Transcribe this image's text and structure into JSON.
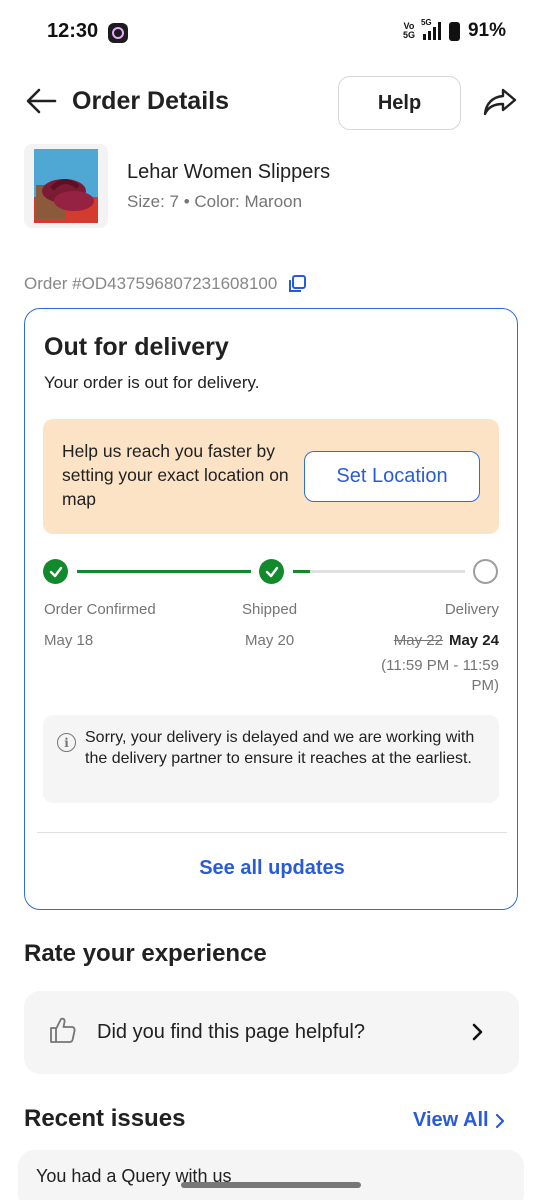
{
  "status_bar": {
    "time": "12:30",
    "network_top": "Vo",
    "network_bottom": "5G",
    "signal_label": "5G",
    "battery": "91%"
  },
  "header": {
    "title": "Order Details",
    "help_label": "Help"
  },
  "product": {
    "name": "Lehar Women Slippers",
    "meta": "Size: 7 • Color: Maroon"
  },
  "order": {
    "id": "Order #OD437596807231608100"
  },
  "status_card": {
    "title": "Out for delivery",
    "subtitle": "Your order is out for delivery.",
    "location_prompt": "Help us reach you faster by setting your exact location on map",
    "set_location_label": "Set Location",
    "steps": [
      {
        "label": "Order Confirmed",
        "date": "May 18",
        "done": true
      },
      {
        "label": "Shipped",
        "date": "May 20",
        "done": true
      },
      {
        "label": "Delivery",
        "old_date": "May 22",
        "new_date": "May 24",
        "window": "(11:59 PM - 11:59 PM)",
        "done": false
      }
    ],
    "progress_after_shipped": 0.1,
    "delay_message": "Sorry, your delivery is delayed and we are working with the delivery partner to ensure it reaches at the earliest.",
    "info_glyph": "i",
    "see_updates_label": "See all updates"
  },
  "rate": {
    "title": "Rate your experience",
    "question": "Did you find this page helpful?"
  },
  "issues": {
    "title": "Recent issues",
    "view_all_label": "View All",
    "first_issue": "You had a Query with us"
  },
  "colors": {
    "accent": "#2a5bd7",
    "success": "#128a2c",
    "banner": "#fde3c6",
    "card_bg": "#f5f5f5"
  }
}
